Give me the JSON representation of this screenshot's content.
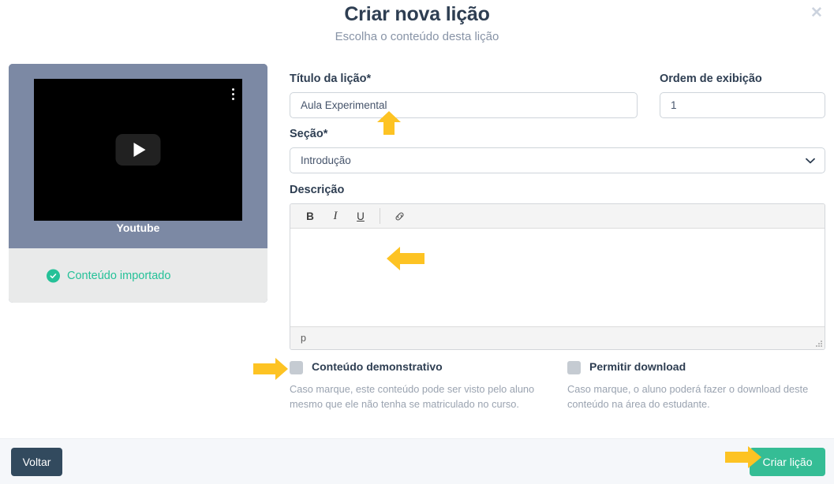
{
  "header": {
    "title": "Criar nova lição",
    "subtitle": "Escolha o conteúdo desta lição",
    "close_label": "✕"
  },
  "media_card": {
    "provider_label": "Youtube",
    "status_text": "Conteúdo importado",
    "status_color": "#25c198",
    "card_color": "#7c89a4",
    "menu_icon": "dots-vertical-icon",
    "play_icon": "play-icon"
  },
  "form": {
    "title_field": {
      "label": "Título da lição",
      "required_mark": "*",
      "value": "Aula Experimental",
      "placeholder": "Título da lição"
    },
    "order_field": {
      "label": "Ordem de exibição",
      "value": "1",
      "placeholder": "0"
    },
    "section_field": {
      "label": "Seção",
      "required_mark": "*",
      "value": "Introdução",
      "options": [
        "Introdução"
      ]
    },
    "description": {
      "label": "Descrição",
      "toolbar": {
        "bold": "B",
        "italic": "I",
        "underline": "U",
        "link_icon": "link-icon"
      },
      "body_value": "",
      "status_path": "p"
    }
  },
  "checkboxes": [
    {
      "label": "Conteúdo demonstrativo",
      "checked": false,
      "help": "Caso marque, este conteúdo pode ser visto pelo aluno mesmo que ele não tenha se matriculado no curso."
    },
    {
      "label": "Permitir download",
      "checked": false,
      "help": "Caso marque, o aluno poderá fazer o download deste conteúdo na área do estudante."
    }
  ],
  "footer": {
    "back_label": "Voltar",
    "create_label": "Criar lição",
    "back_color": "#324a5e",
    "create_color": "#35bd95"
  },
  "annotations": {
    "arrow_color": "#fdc323",
    "items": [
      {
        "name": "arrow-title-field",
        "direction": "up"
      },
      {
        "name": "arrow-description-editor",
        "direction": "left"
      },
      {
        "name": "arrow-demo-checkbox",
        "direction": "right"
      },
      {
        "name": "arrow-create-button",
        "direction": "right"
      }
    ]
  }
}
